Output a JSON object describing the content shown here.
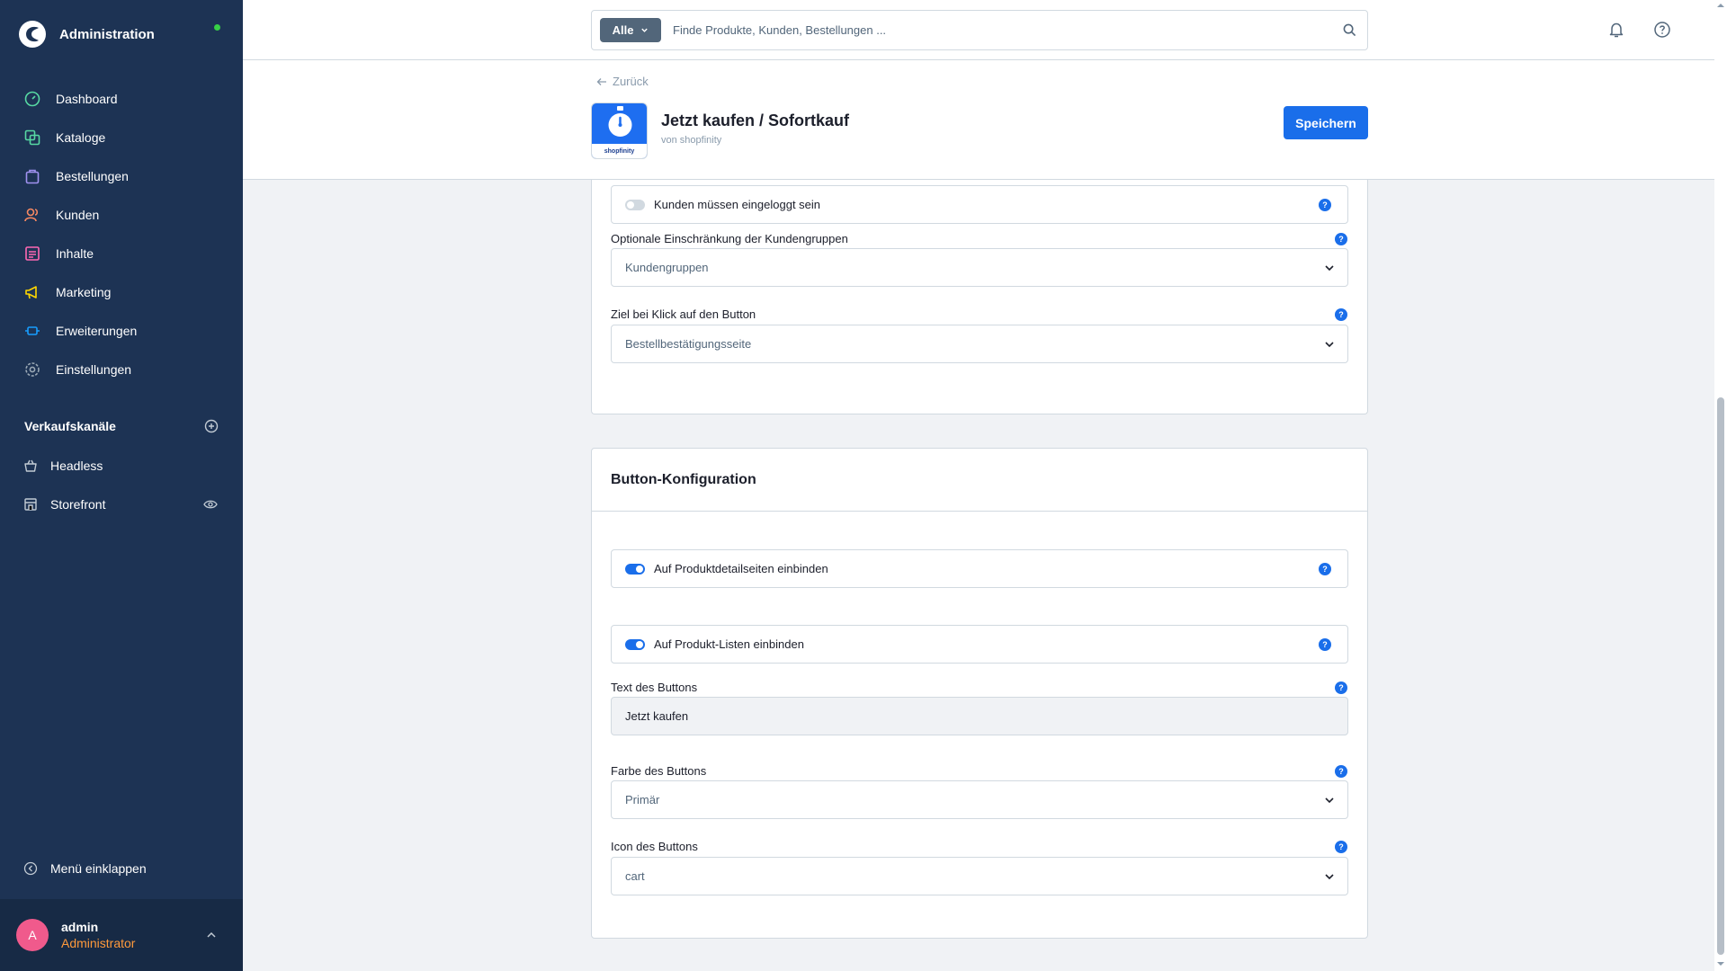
{
  "brand": {
    "title": "Administration"
  },
  "nav": [
    {
      "label": "Dashboard",
      "icon": "dashboard-icon",
      "color": "#57d9a3"
    },
    {
      "label": "Kataloge",
      "icon": "catalog-icon",
      "color": "#57d9a3"
    },
    {
      "label": "Bestellungen",
      "icon": "orders-icon",
      "color": "#a092f0"
    },
    {
      "label": "Kunden",
      "icon": "customers-icon",
      "color": "#f88962"
    },
    {
      "label": "Inhalte",
      "icon": "content-icon",
      "color": "#ff68b4"
    },
    {
      "label": "Marketing",
      "icon": "marketing-icon",
      "color": "#ffd700"
    },
    {
      "label": "Erweiterungen",
      "icon": "extensions-icon",
      "color": "#189eff"
    },
    {
      "label": "Einstellungen",
      "icon": "settings-icon",
      "color": "#9aa8b5"
    }
  ],
  "sales_channels": {
    "title": "Verkaufskanäle",
    "items": [
      {
        "label": "Headless",
        "icon": "basket-icon"
      },
      {
        "label": "Storefront",
        "icon": "storefront-icon"
      }
    ]
  },
  "collapse_label": "Menü einklappen",
  "user": {
    "initial": "A",
    "name": "admin",
    "role": "Administrator"
  },
  "search": {
    "type_label": "Alle",
    "placeholder": "Finde Produkte, Kunden, Bestellungen ..."
  },
  "smartbar": {
    "back_label": "Zurück",
    "app_title": "Jetzt kaufen / Sofortkauf",
    "vendor": "von shopfinity",
    "icon_caption": "shopfinity",
    "save_label": "Speichern"
  },
  "card1": {
    "login_switch": {
      "label": "Kunden müssen eingeloggt sein",
      "checked": false
    },
    "customer_groups": {
      "label": "Optionale Einschränkung der Kundengruppen",
      "value": "Kundengruppen"
    },
    "target": {
      "label": "Ziel bei Klick auf den Button",
      "value": "Bestellbestätigungsseite"
    }
  },
  "card2": {
    "title": "Button-Konfiguration",
    "detail_switch": {
      "label": "Auf Produktdetailseiten einbinden",
      "checked": true
    },
    "listing_switch": {
      "label": "Auf Produkt-Listen einbinden",
      "checked": true
    },
    "button_text": {
      "label": "Text des Buttons",
      "value": "Jetzt kaufen"
    },
    "button_color": {
      "label": "Farbe des Buttons",
      "value": "Primär"
    },
    "button_icon": {
      "label": "Icon des Buttons",
      "value": "cart"
    }
  },
  "help_glyph": "?"
}
